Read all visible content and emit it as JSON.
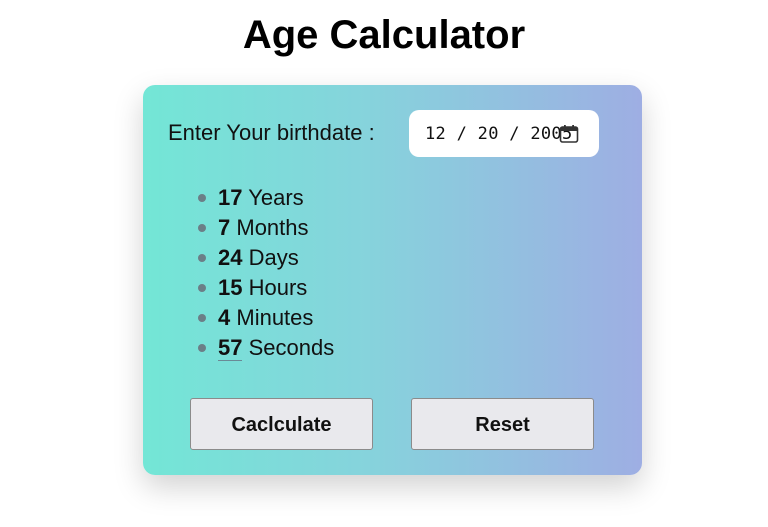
{
  "title": "Age Calculator",
  "birthdate": {
    "label": "Enter Your birthdate :",
    "value": "12 / 20 / 2005",
    "icon": "calendar-icon"
  },
  "results": [
    {
      "value": "17",
      "unit": "Years"
    },
    {
      "value": "7",
      "unit": "Months"
    },
    {
      "value": "24",
      "unit": "Days"
    },
    {
      "value": "15",
      "unit": "Hours"
    },
    {
      "value": "4",
      "unit": "Minutes"
    },
    {
      "value": "57",
      "unit": "Seconds"
    }
  ],
  "buttons": {
    "calculate_label": "Caclculate",
    "reset_label": "Reset"
  },
  "colors": {
    "gradient_start": "#73e6d6",
    "gradient_end": "#9eaee3",
    "button_bg": "#e9e9ed"
  }
}
